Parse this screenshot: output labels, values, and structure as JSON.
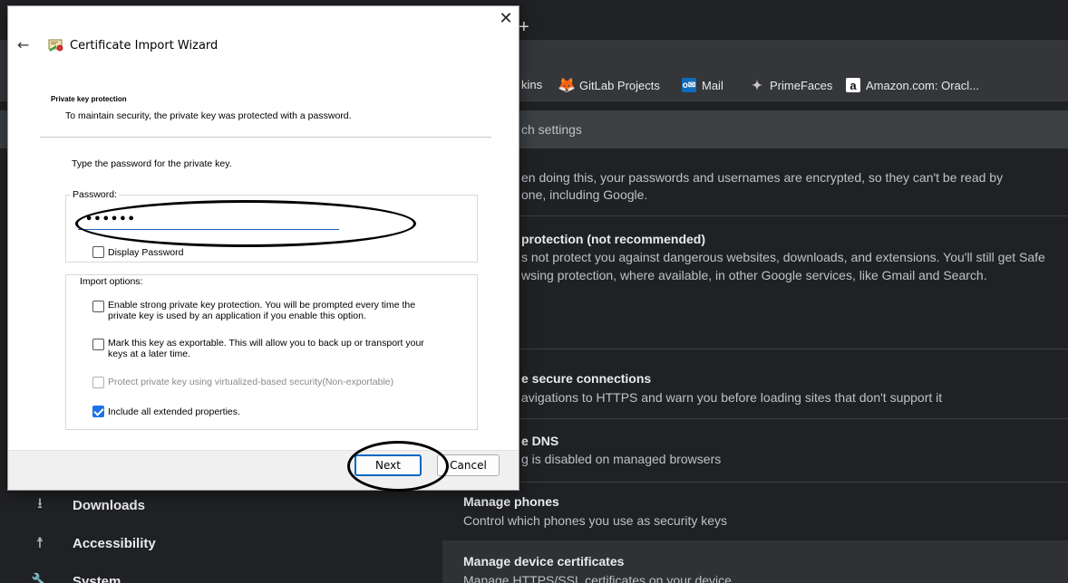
{
  "browser": {
    "new_tab": "+",
    "bookmarks": [
      {
        "label": "kins",
        "icon": "jenkins-icon"
      },
      {
        "label": "GitLab Projects",
        "icon": "gitlab-icon"
      },
      {
        "label": "Mail",
        "icon": "outlook-mail-icon"
      },
      {
        "label": "PrimeFaces",
        "icon": "primefaces-icon"
      },
      {
        "label": "Amazon.com: Oracl...",
        "icon": "amazon-icon"
      }
    ],
    "search_settings": "ch settings",
    "sections": {
      "safe_text1": "en doing this, your passwords and usernames are encrypted, so they can't be read by",
      "safe_text2": "one, including Google.",
      "no_protection_title": "protection (not recommended)",
      "no_protection_text1": "s not protect you against dangerous websites, downloads, and extensions. You'll still get Safe",
      "no_protection_text2": "wsing protection, where available, in other Google services, like Gmail and Search.",
      "secure_conn_title": "e secure connections",
      "secure_conn_text": "avigations to HTTPS and warn you before loading sites that don't support it",
      "dns_title": "e DNS",
      "dns_text": "g is disabled on managed browsers",
      "phones_title": "Manage phones",
      "phones_text": "Control which phones you use as security keys",
      "certs_title": "Manage device certificates",
      "certs_text": "Manage HTTPS/SSL certificates on your device"
    },
    "nav": [
      {
        "label": "Downloads",
        "icon": "download-icon"
      },
      {
        "label": "Accessibility",
        "icon": "accessibility-icon"
      },
      {
        "label": "System",
        "icon": "wrench-icon"
      }
    ]
  },
  "wizard": {
    "title": "Certificate Import Wizard",
    "heading": "Private key protection",
    "description": "To maintain security, the private key was protected with a password.",
    "type_password": "Type the password for the private key.",
    "password_label": "Password:",
    "password_value": "••••••",
    "display_password": "Display Password",
    "import_options_label": "Import options:",
    "options": [
      {
        "line1": "Enable strong private key protection. You will be prompted every time the",
        "line2": "private key is used by an application if you enable this option.",
        "checked": false,
        "disabled": false
      },
      {
        "line1": "Mark this key as exportable. This will allow you to back up or transport your",
        "line2": "keys at a later time.",
        "checked": false,
        "disabled": false
      },
      {
        "line1": "Protect private key using virtualized-based security(Non-exportable)",
        "line2": "",
        "checked": false,
        "disabled": true
      },
      {
        "line1": "Include all extended properties.",
        "line2": "",
        "checked": true,
        "disabled": false
      }
    ],
    "next_label": "Next",
    "cancel_label": "Cancel",
    "close_glyph": "✕",
    "back_glyph": "←"
  },
  "colors": {
    "browser_bg": "#202124",
    "accent_blue": "#1a73e8",
    "annotation": "#000000"
  }
}
